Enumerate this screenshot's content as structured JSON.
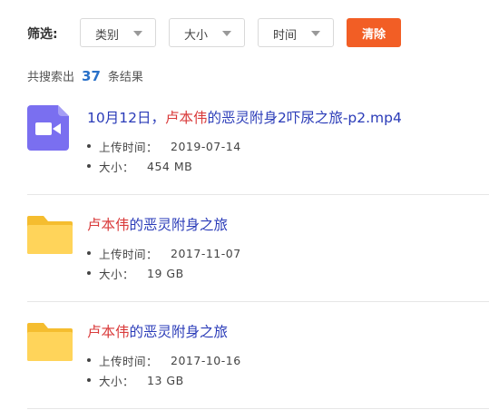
{
  "filter": {
    "label": "筛选:",
    "type_label": "类别",
    "size_label": "大小",
    "time_label": "时间",
    "clear_label": "清除",
    "accent_color": "#f25e25"
  },
  "summary": {
    "prefix": "共搜索出",
    "count": "37",
    "suffix": "条结果"
  },
  "results": [
    {
      "icon": "video-file-icon",
      "title_pre": "10月12日，",
      "title_hl": "卢本伟",
      "title_post": "的恶灵附身2吓尿之旅-p2.mp4",
      "upload_key": "上传时间：",
      "upload_value": "2019-07-14",
      "size_key": "大小：",
      "size_value": "454 MB"
    },
    {
      "icon": "folder-icon",
      "title_pre": "",
      "title_hl": "卢本伟",
      "title_post": "的恶灵附身之旅",
      "upload_key": "上传时间：",
      "upload_value": "2017-11-07",
      "size_key": "大小：",
      "size_value": "19 GB"
    },
    {
      "icon": "folder-icon",
      "title_pre": "",
      "title_hl": "卢本伟",
      "title_post": "的恶灵附身之旅",
      "upload_key": "上传时间：",
      "upload_value": "2017-10-16",
      "size_key": "大小：",
      "size_value": "13 GB"
    }
  ]
}
